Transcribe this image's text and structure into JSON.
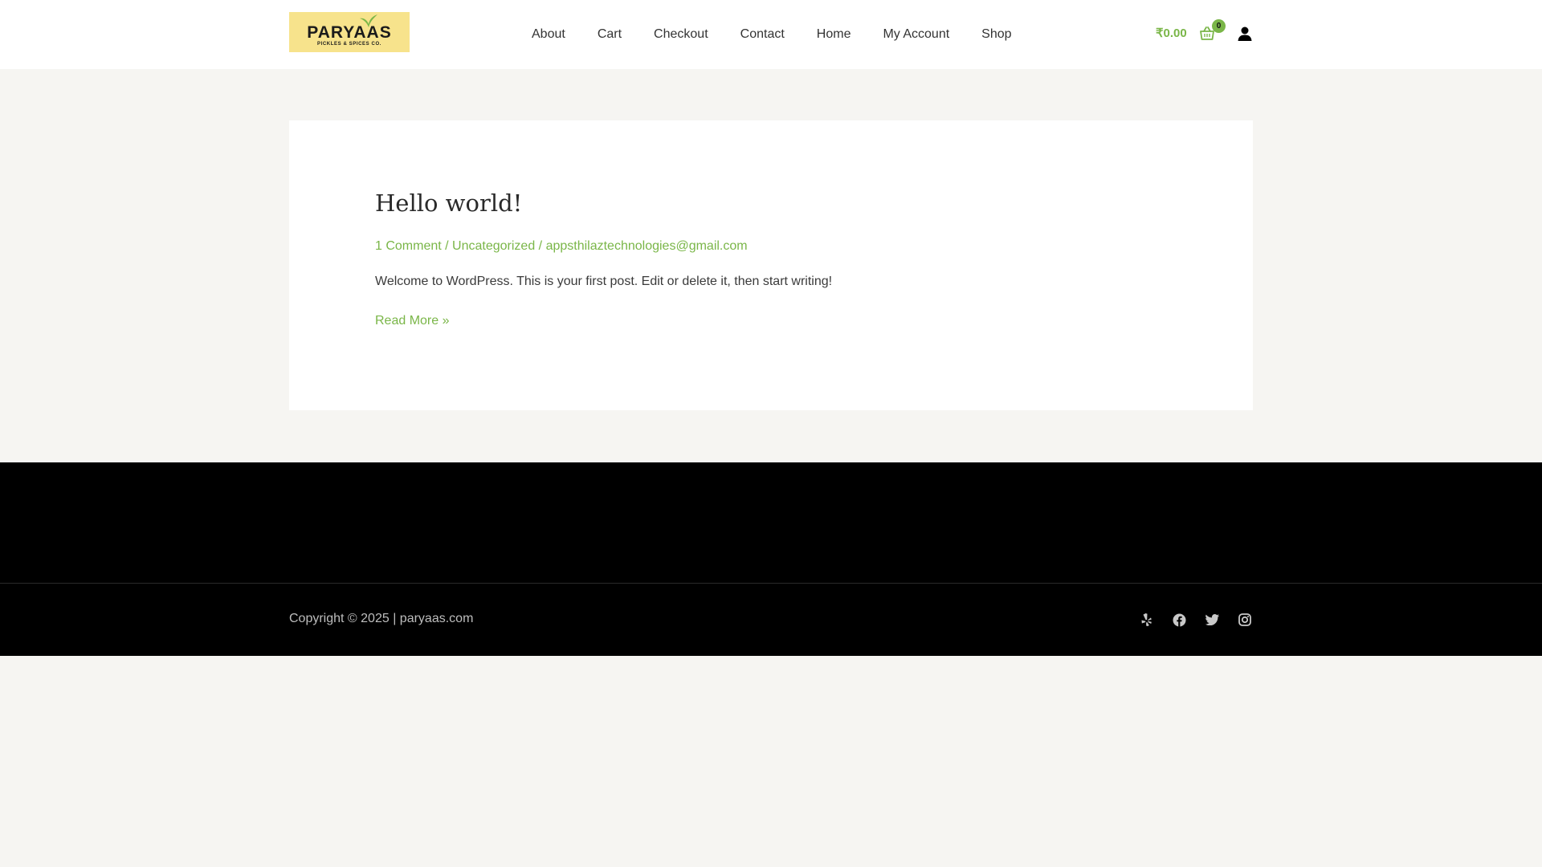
{
  "header": {
    "logo": {
      "name": "PARYAAS",
      "tagline": "PICKLES & SPICES CO."
    },
    "nav": [
      {
        "label": "About"
      },
      {
        "label": "Cart"
      },
      {
        "label": "Checkout"
      },
      {
        "label": "Contact"
      },
      {
        "label": "Home"
      },
      {
        "label": "My Account"
      },
      {
        "label": "Shop"
      }
    ],
    "cart": {
      "total": "₹0.00",
      "count": "0"
    }
  },
  "post": {
    "title": "Hello world!",
    "comments": "1 Comment",
    "category": "Uncategorized",
    "author": "appsthilaztechnologies@gmail.com",
    "separator": " / ",
    "excerpt": "Welcome to WordPress. This is your first post. Edit or delete it, then start writing!",
    "read_more": "Read More »"
  },
  "footer": {
    "copyright": "Copyright © 2025 | paryaas.com",
    "socials": [
      "yelp-icon",
      "facebook-icon",
      "twitter-icon",
      "instagram-icon"
    ]
  },
  "colors": {
    "accent": "#7ab648",
    "page_bg": "#f6f5f2",
    "footer_bg": "#000000",
    "logo_bg": "#f7e38c"
  }
}
